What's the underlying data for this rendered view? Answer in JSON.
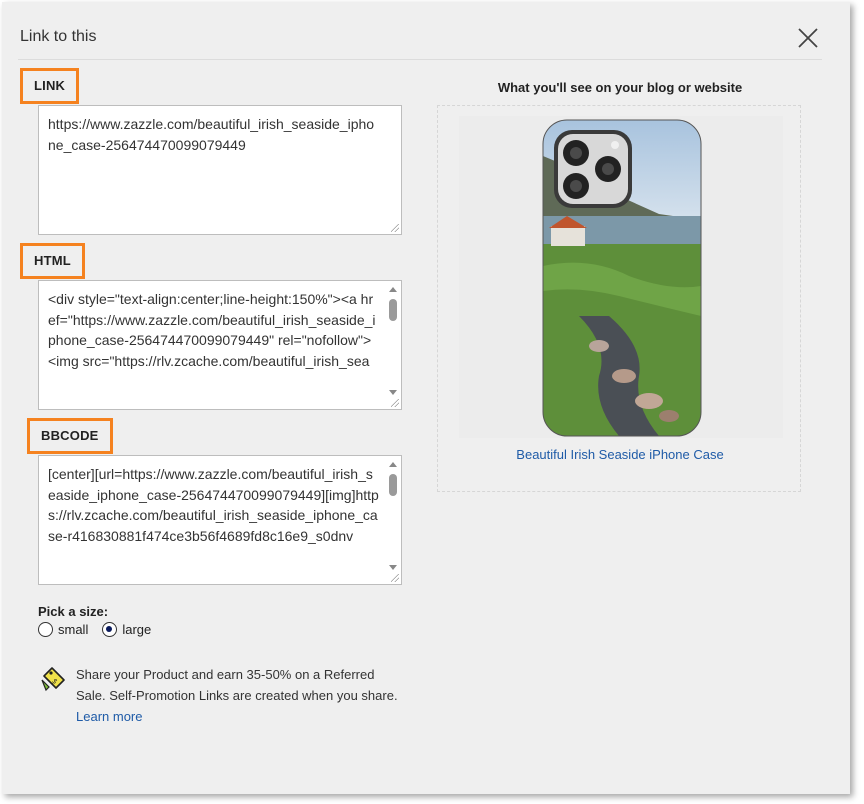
{
  "dialog": {
    "title": "Link to this"
  },
  "fields": {
    "link": {
      "label": "LINK",
      "value": "https://www.zazzle.com/beautiful_irish_seaside_iphone_case-256474470099079449"
    },
    "html": {
      "label": "HTML",
      "value": "<div style=\"text-align:center;line-height:150%\"><a href=\"https://www.zazzle.com/beautiful_irish_seaside_iphone_case-256474470099079449\" rel=\"nofollow\"><img src=\"https://rlv.zcache.com/beautiful_irish_sea"
    },
    "bbcode": {
      "label": "BBCODE",
      "value": "[center][url=https://www.zazzle.com/beautiful_irish_seaside_iphone_case-256474470099079449][img]https://rlv.zcache.com/beautiful_irish_seaside_iphone_case-r416830881f474ce3b56f4689fd8c16e9_s0dnv"
    }
  },
  "size": {
    "label": "Pick a size:",
    "options": [
      "small",
      "large"
    ],
    "selected": "large"
  },
  "promo": {
    "text": "Share your Product and earn 35-50% on a Referred Sale. Self-Promotion Links are created when you share.",
    "link": "Learn more"
  },
  "preview": {
    "title": "What you'll see on your blog or website",
    "caption": "Beautiful Irish Seaside iPhone Case"
  },
  "colors": {
    "highlight": "#f5821f",
    "link": "#1f5ba7"
  }
}
